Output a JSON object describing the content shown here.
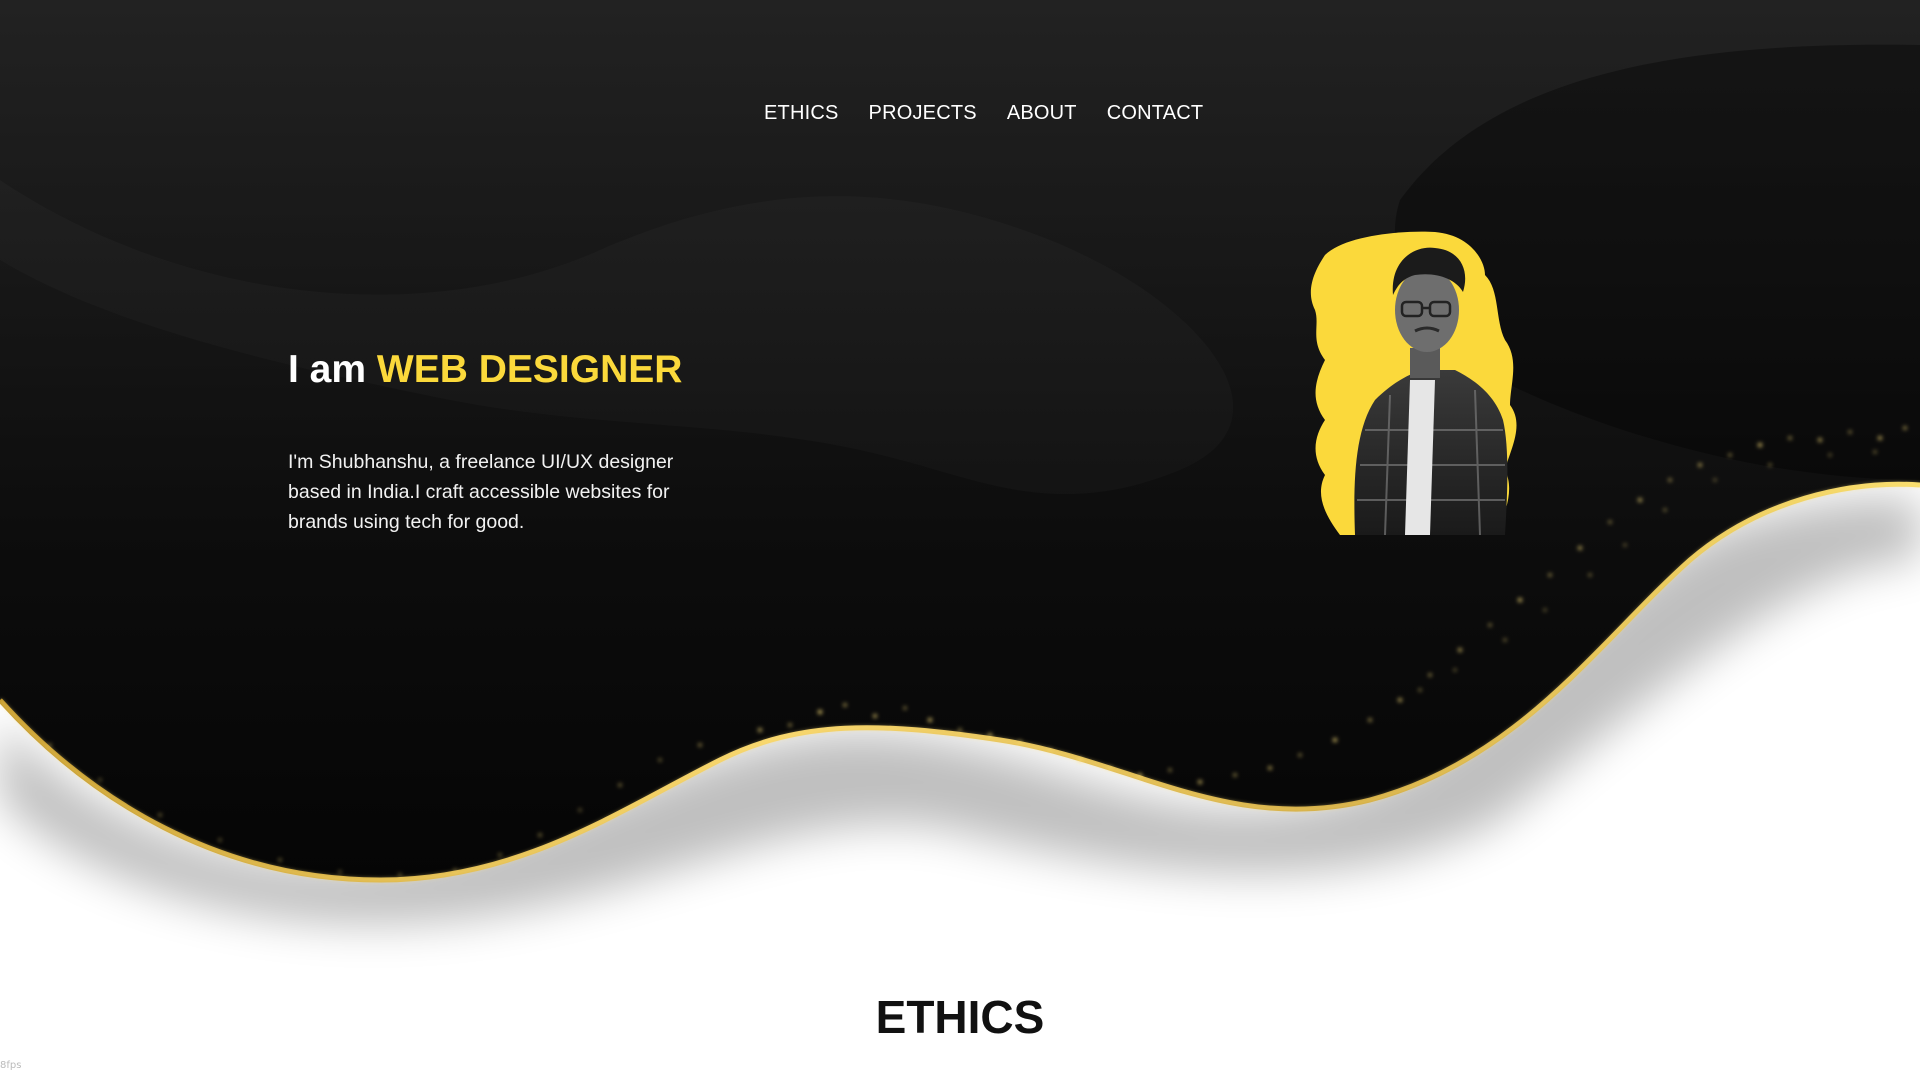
{
  "nav": {
    "items": [
      {
        "label": "ETHICS"
      },
      {
        "label": "PROJECTS"
      },
      {
        "label": "ABOUT"
      },
      {
        "label": "CONTACT"
      }
    ]
  },
  "hero": {
    "title_prefix": "I am",
    "title_accent": "WEB DESIGNER",
    "description": "I'm Shubhanshu, a freelance UI/UX designer based in India.I craft accessible websites for brands using tech for good."
  },
  "sections": {
    "ethics_title": "ETHICS"
  },
  "footer": {
    "corner_text": "8fps"
  },
  "colors": {
    "accent": "#fbd93b",
    "background_dark": "#0a0a0a",
    "wave_gold": "#e8c24a"
  }
}
